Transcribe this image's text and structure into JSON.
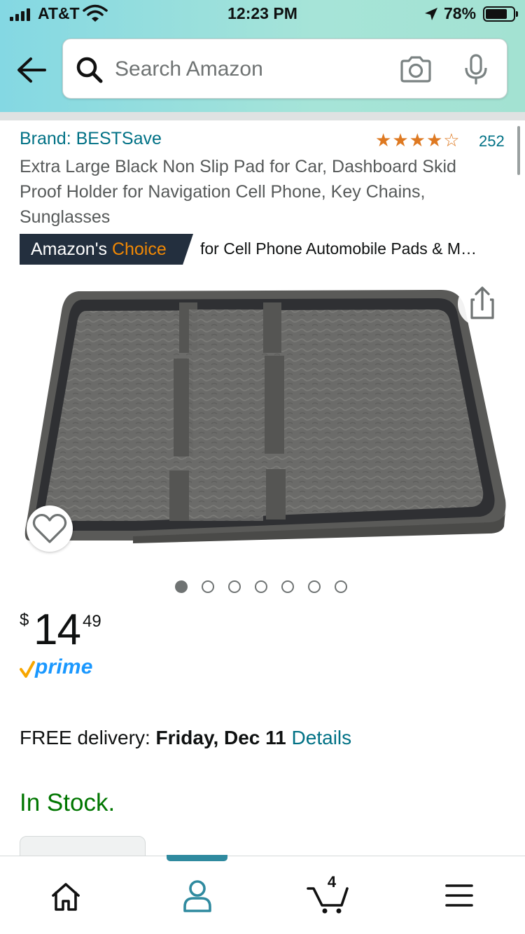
{
  "status_bar": {
    "carrier": "AT&T",
    "time": "12:23 PM",
    "battery_percent": "78%",
    "battery_level": 0.78
  },
  "search": {
    "placeholder": "Search Amazon"
  },
  "product": {
    "brand": "Brand: BESTSave",
    "rating": 4.5,
    "review_count": "252",
    "title": "Extra Large Black Non Slip Pad for Car, Dashboard Skid Proof Holder for Navigation Cell Phone, Key Chains, Sunglasses",
    "badge_prefix": "Amazon's ",
    "badge_accent": "Choice",
    "badge_category": "for Cell Phone Automobile Pads & M…",
    "image_count": 7,
    "active_image_index": 0,
    "price_symbol": "$",
    "price_whole": "14",
    "price_fraction": "49",
    "prime_label": "prime",
    "delivery_prefix": "FREE delivery: ",
    "delivery_date": "Friday, Dec 11",
    "delivery_link": "Details",
    "stock_status": "In Stock."
  },
  "bottom_nav": {
    "items": [
      "home",
      "account",
      "cart",
      "menu"
    ],
    "active": "account",
    "cart_count": "4"
  },
  "colors": {
    "link": "#007185",
    "star": "#de7921",
    "in_stock": "#007600",
    "badge_bg": "#232f3e",
    "badge_accent": "#f08804",
    "prime_blue": "#1a98ff",
    "nav_accent": "#2f8a9f"
  },
  "icons": [
    "signal-icon",
    "wifi-icon",
    "location-arrow-icon",
    "battery-icon",
    "back-arrow-icon",
    "search-icon",
    "camera-icon",
    "microphone-icon",
    "share-icon",
    "heart-icon",
    "home-icon",
    "account-icon",
    "cart-icon",
    "hamburger-menu-icon"
  ]
}
